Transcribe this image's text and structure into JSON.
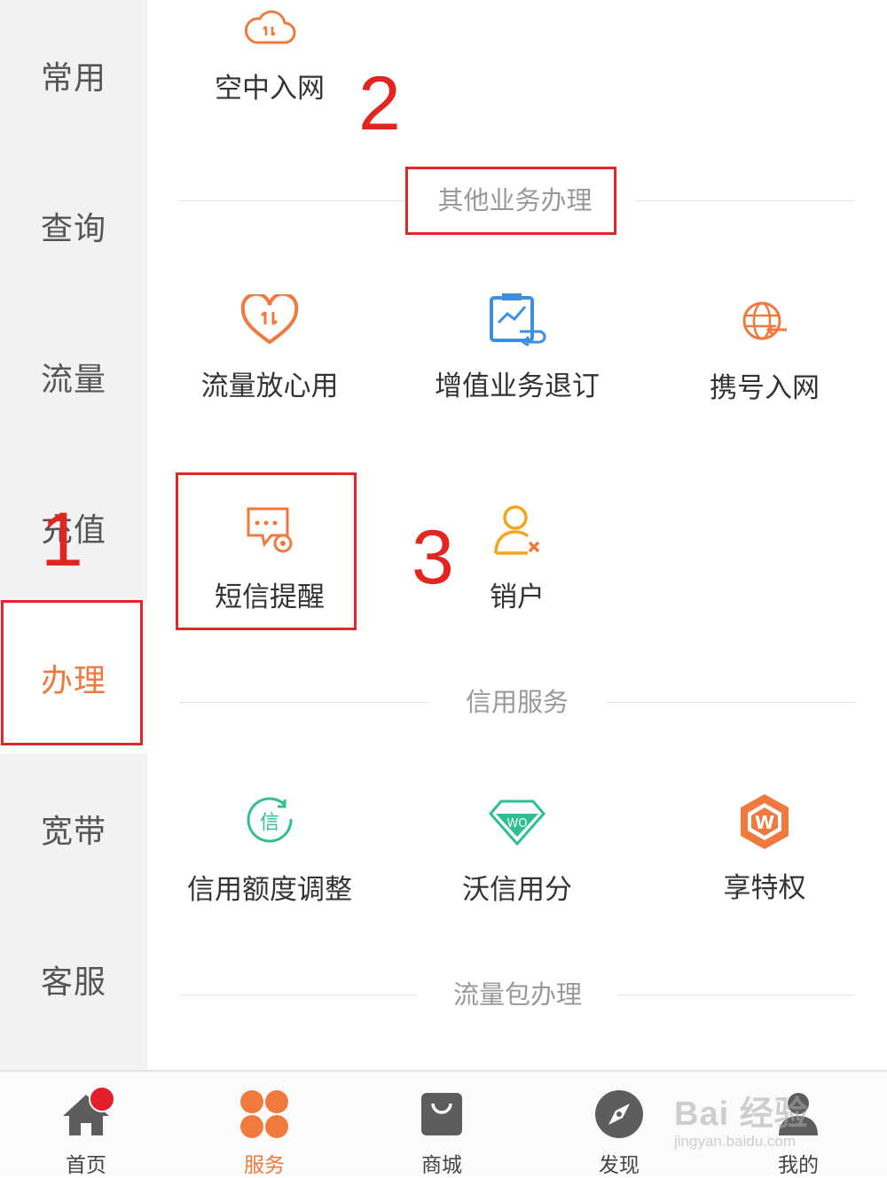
{
  "sidebar": {
    "items": [
      {
        "label": "常用",
        "active": false
      },
      {
        "label": "查询",
        "active": false
      },
      {
        "label": "流量",
        "active": false
      },
      {
        "label": "充值",
        "active": false
      },
      {
        "label": "办理",
        "active": true
      },
      {
        "label": "宽带",
        "active": false
      },
      {
        "label": "客服",
        "active": false
      }
    ]
  },
  "main": {
    "top_services": [
      {
        "label": "空中入网",
        "icon": "cloud-transfer-icon"
      }
    ],
    "sections": [
      {
        "title": "其他业务办理",
        "services": [
          {
            "label": "流量放心用",
            "icon": "heart-transfer-icon"
          },
          {
            "label": "增值业务退订",
            "icon": "chart-return-icon"
          },
          {
            "label": "携号入网",
            "icon": "globe-arrow-icon"
          },
          {
            "label": "短信提醒",
            "icon": "message-gear-icon"
          },
          {
            "label": "销户",
            "icon": "user-remove-icon"
          }
        ]
      },
      {
        "title": "信用服务",
        "services": [
          {
            "label": "信用额度调整",
            "icon": "credit-circle-icon",
            "icon_text": "信"
          },
          {
            "label": "沃信用分",
            "icon": "diamond-wo-icon",
            "icon_text": "WO"
          },
          {
            "label": "享特权",
            "icon": "hexagon-w-icon",
            "icon_text": "W"
          }
        ]
      },
      {
        "title": "流量包办理",
        "services": []
      }
    ]
  },
  "annotations": {
    "numbers": [
      "1",
      "2",
      "3"
    ],
    "color": "#e0272a"
  },
  "tabbar": {
    "tabs": [
      {
        "label": "首页",
        "icon": "home-icon",
        "active": false,
        "badge": true
      },
      {
        "label": "服务",
        "icon": "services-grid-icon",
        "active": true
      },
      {
        "label": "商城",
        "icon": "shopping-bag-icon",
        "active": false
      },
      {
        "label": "发现",
        "icon": "compass-icon",
        "active": false
      },
      {
        "label": "我的",
        "icon": "user-icon",
        "active": false
      }
    ]
  },
  "watermark": {
    "line1": "Bai 经验",
    "line2": "jingyan.baidu.com"
  },
  "colors": {
    "accent": "#f07a3e",
    "sidebar_bg": "#f2f2f2",
    "credit_green": "#2fbf8f",
    "chart_blue": "#3d8fe0",
    "user_yellow": "#f3a61a",
    "badge_red": "#e41e2b"
  }
}
